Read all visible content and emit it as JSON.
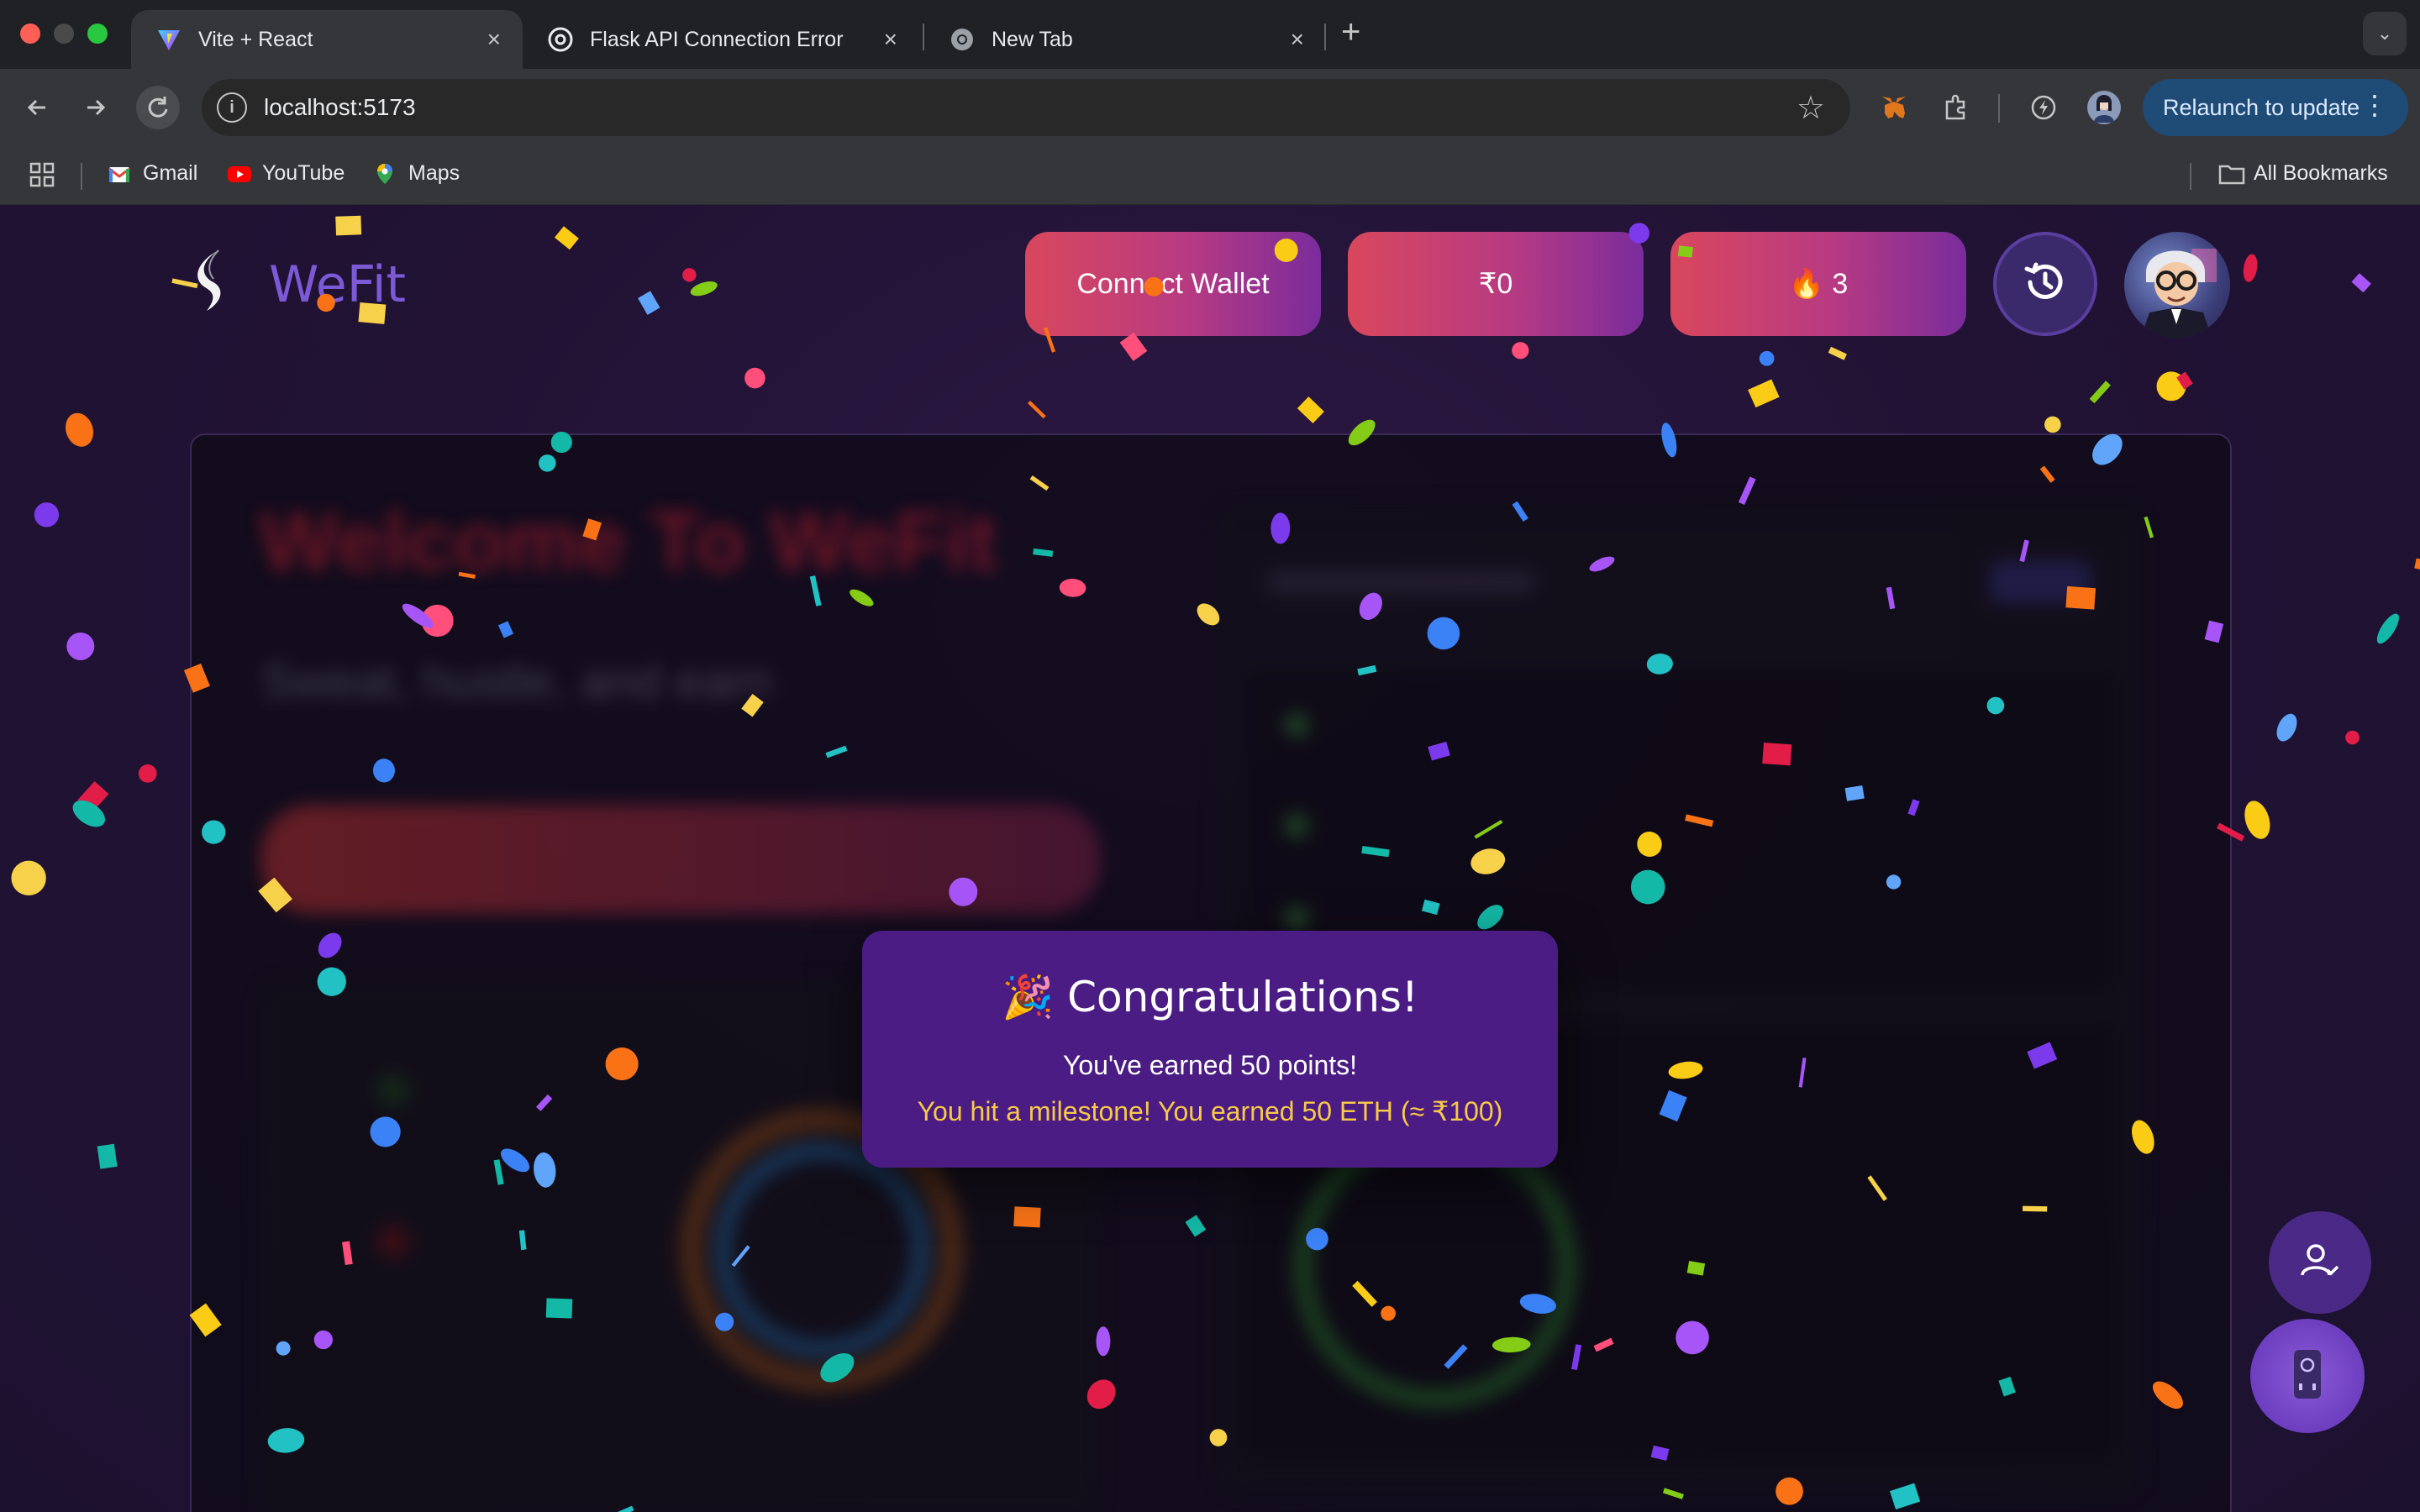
{
  "browser": {
    "tabs": [
      {
        "title": "Vite + React",
        "active": true
      },
      {
        "title": "Flask API Connection Error",
        "active": false
      },
      {
        "title": "New Tab",
        "active": false
      }
    ],
    "url": "localhost:5173",
    "relaunch_label": "Relaunch to update",
    "bookmarks": [
      {
        "label": "Gmail",
        "icon": "gmail-icon"
      },
      {
        "label": "YouTube",
        "icon": "youtube-icon"
      },
      {
        "label": "Maps",
        "icon": "maps-icon"
      }
    ],
    "all_bookmarks_label": "All Bookmarks"
  },
  "app": {
    "brand": "WeFit",
    "connect_wallet_label": "Connect Wallet",
    "balance_label": "₹0",
    "streak_label": "🔥 3",
    "hero_title": "Welcome To WeFit",
    "hero_subtitle": "Sweat, hustle, and earn"
  },
  "modal": {
    "title": "🎉 Congratulations!",
    "points_text": "You've earned 50 points!",
    "milestone_text": "You hit a milestone! You earned 50 ETH (≈ ₹100)"
  },
  "colors": {
    "page_bg": "#221335",
    "button_gradient_start": "#d9475d",
    "button_gradient_end": "#7a2c9c",
    "modal_bg": "#4a1c84",
    "milestone_text": "#f7c948",
    "brand_text": "#7c5ad6"
  }
}
